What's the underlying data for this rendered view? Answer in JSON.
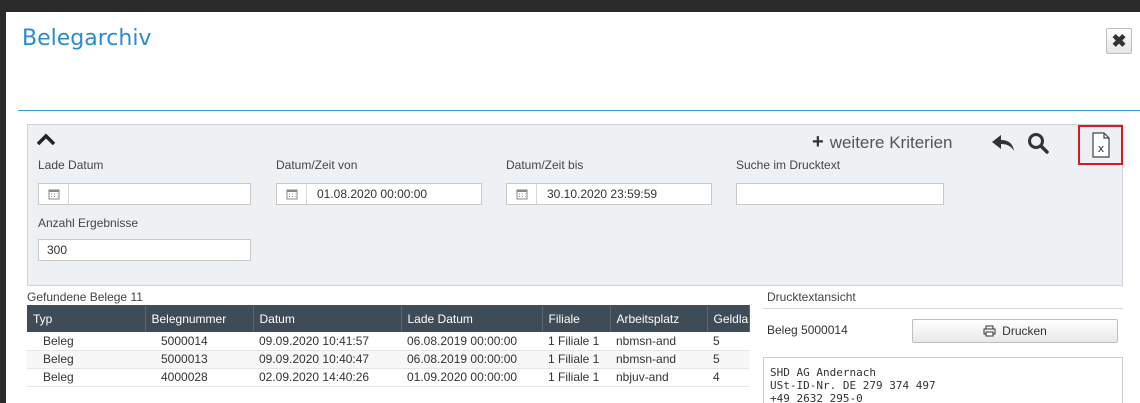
{
  "dialog": {
    "title": "Belegarchiv",
    "close_glyph": "✖"
  },
  "filter": {
    "more_criteria_label": "weitere Kriterien",
    "load_date_label": "Lade Datum",
    "load_date_value": "",
    "date_from_label": "Datum/Zeit von",
    "date_from_value": "01.08.2020 00:00:00",
    "date_to_label": "Datum/Zeit bis",
    "date_to_value": "30.10.2020 23:59:59",
    "search_text_label": "Suche im Drucktext",
    "search_text_value": "",
    "result_count_label": "Anzahl Ergebnisse",
    "result_count_value": "300",
    "icons": [
      "chevron-up-icon",
      "plus-icon",
      "undo-icon",
      "search-icon",
      "excel-export-icon",
      "calendar-icon"
    ]
  },
  "results": {
    "label": "Gefundene Belege",
    "count": "11",
    "columns": [
      "Typ",
      "Belegnummer",
      "Datum",
      "Lade Datum",
      "Filiale",
      "Arbeitsplatz",
      "Geldla"
    ],
    "rows": [
      [
        "Beleg",
        "5000014",
        "09.09.2020 10:41:57",
        "06.08.2019 00:00:00",
        "1 Filiale 1",
        "nbmsn-and",
        "5"
      ],
      [
        "Beleg",
        "5000013",
        "09.09.2020 10:40:47",
        "06.08.2019 00:00:00",
        "1 Filiale 1",
        "nbmsn-and",
        "5"
      ],
      [
        "Beleg",
        "4000028",
        "02.09.2020 14:40:26",
        "01.09.2020 00:00:00",
        "1 Filiale 1",
        "nbjuv-and",
        "4"
      ]
    ]
  },
  "print_view": {
    "title": "Drucktextansicht",
    "beleg_label": "Beleg 5000014",
    "print_button": "Drucken",
    "text_lines": [
      "SHD AG Andernach",
      "USt-ID-Nr. DE 279 374 497",
      "+49 2632 295-0"
    ]
  },
  "colors": {
    "accent": "#2a8ccd",
    "grid_header": "#3e4c58",
    "highlight": "#e0161f"
  }
}
